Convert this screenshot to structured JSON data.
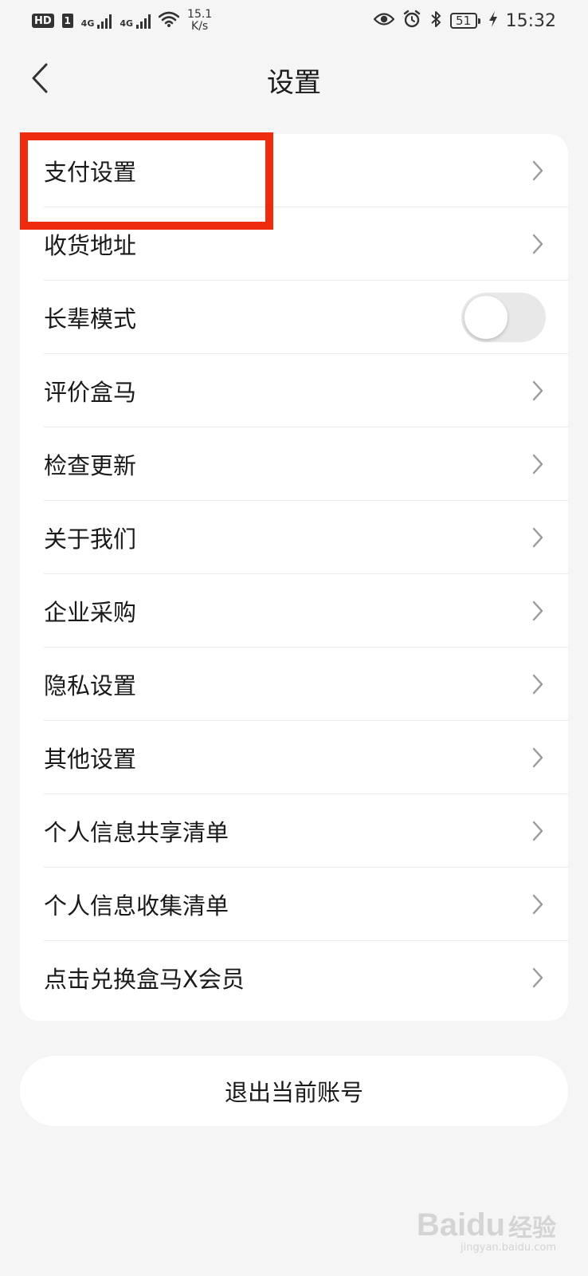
{
  "status_bar": {
    "hd_label": "HD",
    "sim_label": "1",
    "network_1": "4G",
    "network_2": "4G",
    "speed_value": "15.1",
    "speed_unit": "K/s",
    "battery_level": "51",
    "time": "15:32"
  },
  "header": {
    "title": "设置"
  },
  "settings": {
    "items": [
      {
        "label": "支付设置",
        "control": "chevron"
      },
      {
        "label": "收货地址",
        "control": "chevron"
      },
      {
        "label": "长辈模式",
        "control": "toggle",
        "toggle_on": false
      },
      {
        "label": "评价盒马",
        "control": "chevron"
      },
      {
        "label": "检查更新",
        "control": "chevron"
      },
      {
        "label": "关于我们",
        "control": "chevron"
      },
      {
        "label": "企业采购",
        "control": "chevron"
      },
      {
        "label": "隐私设置",
        "control": "chevron"
      },
      {
        "label": "其他设置",
        "control": "chevron"
      },
      {
        "label": "个人信息共享清单",
        "control": "chevron"
      },
      {
        "label": "个人信息收集清单",
        "control": "chevron"
      },
      {
        "label": "点击兑换盒马X会员",
        "control": "chevron"
      }
    ]
  },
  "logout": {
    "label": "退出当前账号"
  },
  "annotation": {
    "highlight_color": "#ee2b0c"
  },
  "watermark": {
    "brand": "Baidu",
    "product": "经验",
    "url": "jingyan.baidu.com"
  },
  "icons": {
    "back": "back-arrow-icon",
    "chevron": "chevron-right-icon",
    "eye": "eye-comfort-icon",
    "alarm": "alarm-icon",
    "bluetooth": "bluetooth-icon",
    "wifi": "wifi-icon",
    "charging": "charging-icon"
  }
}
